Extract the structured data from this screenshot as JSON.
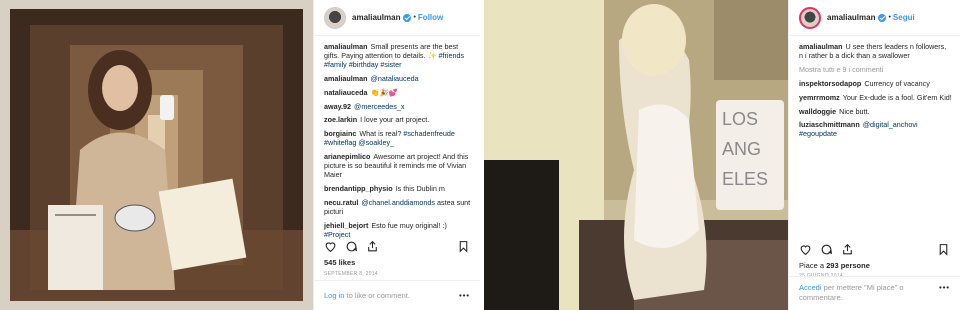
{
  "post1": {
    "username": "amaliaulman",
    "follow_label": "Follow",
    "dot": "•",
    "comments": [
      {
        "user": "amaliaulman",
        "text": "Small presents are the best gifts. Paying attention to details. ✨ #friends #family #birthday #sister"
      },
      {
        "user": "amaliaulman",
        "text": "@nataliauceda"
      },
      {
        "user": "nataliauceda",
        "text": "👏🎉💕"
      },
      {
        "user": "away.92",
        "text": "@merceedes_x"
      },
      {
        "user": "zoe.larkin",
        "text": "I love your art project."
      },
      {
        "user": "borgiainc",
        "text": "What is real? #schadenfreude #whiteflag @soakley_"
      },
      {
        "user": "arianepimlico",
        "text": "Awesome art project! And this picture is so beautiful it reminds me of Vivian Maier"
      },
      {
        "user": "brendantipp_physio",
        "text": "Is this Dublin m"
      },
      {
        "user": "necu.ratul",
        "text": "@chanel.anddiamonds astea sunt picturi"
      },
      {
        "user": "jehiell_bejort",
        "text": "Esto fue muy original! :) #Project"
      }
    ],
    "likes": "545 likes",
    "date": "SEPTEMBER 8, 2014",
    "login_link": "Log in",
    "login_rest": " to like or comment.",
    "more": "•••"
  },
  "post2": {
    "username": "amaliaulman",
    "follow_label": "Segui",
    "dot": "•",
    "caption_user": "amaliaulman",
    "caption_text": "U see thers leaders n followers, n i rather b a dick than a swallower",
    "view_all": "Mostra tutti e 9 i commenti",
    "comments": [
      {
        "user": "inspektorsodapop",
        "text": "Currency of vacancy"
      },
      {
        "user": "yemrrmomz",
        "text": "Your Ex-dude is a fool. Git'em Kid!"
      },
      {
        "user": "walldoggie",
        "text": "Nice butt."
      },
      {
        "user": "luziaschmittmann",
        "text": "@digital_anchovi #egoupdate"
      }
    ],
    "likes_prefix": "Piace a ",
    "likes_count": "293 persone",
    "date": "25 GIUGNO 2014",
    "login_link": "Accedi",
    "login_rest": " per mettere \"Mi piace\" o commentare.",
    "more": "•••",
    "sign_text": "LOS ANG ELES"
  },
  "colors": {
    "link": "#3897f0",
    "tag": "#003569",
    "muted": "#999999"
  }
}
